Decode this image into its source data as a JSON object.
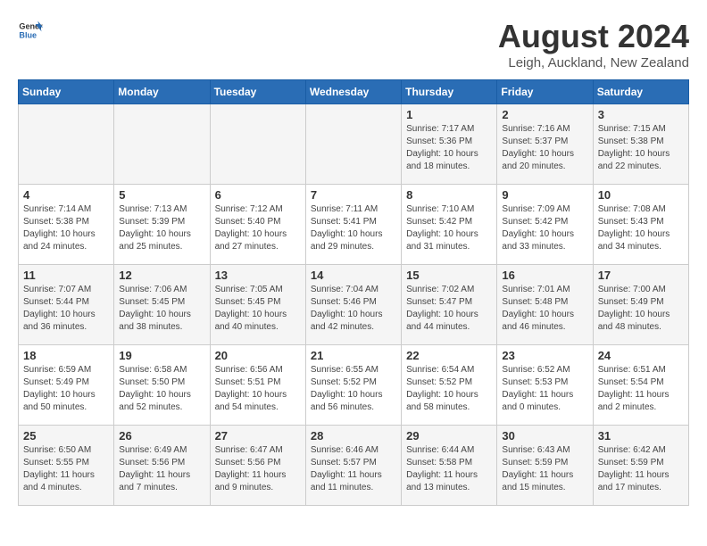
{
  "header": {
    "logo_general": "General",
    "logo_blue": "Blue",
    "month_year": "August 2024",
    "location": "Leigh, Auckland, New Zealand"
  },
  "days_of_week": [
    "Sunday",
    "Monday",
    "Tuesday",
    "Wednesday",
    "Thursday",
    "Friday",
    "Saturday"
  ],
  "weeks": [
    [
      {
        "day": "",
        "info": ""
      },
      {
        "day": "",
        "info": ""
      },
      {
        "day": "",
        "info": ""
      },
      {
        "day": "",
        "info": ""
      },
      {
        "day": "1",
        "info": "Sunrise: 7:17 AM\nSunset: 5:36 PM\nDaylight: 10 hours\nand 18 minutes."
      },
      {
        "day": "2",
        "info": "Sunrise: 7:16 AM\nSunset: 5:37 PM\nDaylight: 10 hours\nand 20 minutes."
      },
      {
        "day": "3",
        "info": "Sunrise: 7:15 AM\nSunset: 5:38 PM\nDaylight: 10 hours\nand 22 minutes."
      }
    ],
    [
      {
        "day": "4",
        "info": "Sunrise: 7:14 AM\nSunset: 5:38 PM\nDaylight: 10 hours\nand 24 minutes."
      },
      {
        "day": "5",
        "info": "Sunrise: 7:13 AM\nSunset: 5:39 PM\nDaylight: 10 hours\nand 25 minutes."
      },
      {
        "day": "6",
        "info": "Sunrise: 7:12 AM\nSunset: 5:40 PM\nDaylight: 10 hours\nand 27 minutes."
      },
      {
        "day": "7",
        "info": "Sunrise: 7:11 AM\nSunset: 5:41 PM\nDaylight: 10 hours\nand 29 minutes."
      },
      {
        "day": "8",
        "info": "Sunrise: 7:10 AM\nSunset: 5:42 PM\nDaylight: 10 hours\nand 31 minutes."
      },
      {
        "day": "9",
        "info": "Sunrise: 7:09 AM\nSunset: 5:42 PM\nDaylight: 10 hours\nand 33 minutes."
      },
      {
        "day": "10",
        "info": "Sunrise: 7:08 AM\nSunset: 5:43 PM\nDaylight: 10 hours\nand 34 minutes."
      }
    ],
    [
      {
        "day": "11",
        "info": "Sunrise: 7:07 AM\nSunset: 5:44 PM\nDaylight: 10 hours\nand 36 minutes."
      },
      {
        "day": "12",
        "info": "Sunrise: 7:06 AM\nSunset: 5:45 PM\nDaylight: 10 hours\nand 38 minutes."
      },
      {
        "day": "13",
        "info": "Sunrise: 7:05 AM\nSunset: 5:45 PM\nDaylight: 10 hours\nand 40 minutes."
      },
      {
        "day": "14",
        "info": "Sunrise: 7:04 AM\nSunset: 5:46 PM\nDaylight: 10 hours\nand 42 minutes."
      },
      {
        "day": "15",
        "info": "Sunrise: 7:02 AM\nSunset: 5:47 PM\nDaylight: 10 hours\nand 44 minutes."
      },
      {
        "day": "16",
        "info": "Sunrise: 7:01 AM\nSunset: 5:48 PM\nDaylight: 10 hours\nand 46 minutes."
      },
      {
        "day": "17",
        "info": "Sunrise: 7:00 AM\nSunset: 5:49 PM\nDaylight: 10 hours\nand 48 minutes."
      }
    ],
    [
      {
        "day": "18",
        "info": "Sunrise: 6:59 AM\nSunset: 5:49 PM\nDaylight: 10 hours\nand 50 minutes."
      },
      {
        "day": "19",
        "info": "Sunrise: 6:58 AM\nSunset: 5:50 PM\nDaylight: 10 hours\nand 52 minutes."
      },
      {
        "day": "20",
        "info": "Sunrise: 6:56 AM\nSunset: 5:51 PM\nDaylight: 10 hours\nand 54 minutes."
      },
      {
        "day": "21",
        "info": "Sunrise: 6:55 AM\nSunset: 5:52 PM\nDaylight: 10 hours\nand 56 minutes."
      },
      {
        "day": "22",
        "info": "Sunrise: 6:54 AM\nSunset: 5:52 PM\nDaylight: 10 hours\nand 58 minutes."
      },
      {
        "day": "23",
        "info": "Sunrise: 6:52 AM\nSunset: 5:53 PM\nDaylight: 11 hours\nand 0 minutes."
      },
      {
        "day": "24",
        "info": "Sunrise: 6:51 AM\nSunset: 5:54 PM\nDaylight: 11 hours\nand 2 minutes."
      }
    ],
    [
      {
        "day": "25",
        "info": "Sunrise: 6:50 AM\nSunset: 5:55 PM\nDaylight: 11 hours\nand 4 minutes."
      },
      {
        "day": "26",
        "info": "Sunrise: 6:49 AM\nSunset: 5:56 PM\nDaylight: 11 hours\nand 7 minutes."
      },
      {
        "day": "27",
        "info": "Sunrise: 6:47 AM\nSunset: 5:56 PM\nDaylight: 11 hours\nand 9 minutes."
      },
      {
        "day": "28",
        "info": "Sunrise: 6:46 AM\nSunset: 5:57 PM\nDaylight: 11 hours\nand 11 minutes."
      },
      {
        "day": "29",
        "info": "Sunrise: 6:44 AM\nSunset: 5:58 PM\nDaylight: 11 hours\nand 13 minutes."
      },
      {
        "day": "30",
        "info": "Sunrise: 6:43 AM\nSunset: 5:59 PM\nDaylight: 11 hours\nand 15 minutes."
      },
      {
        "day": "31",
        "info": "Sunrise: 6:42 AM\nSunset: 5:59 PM\nDaylight: 11 hours\nand 17 minutes."
      }
    ]
  ]
}
